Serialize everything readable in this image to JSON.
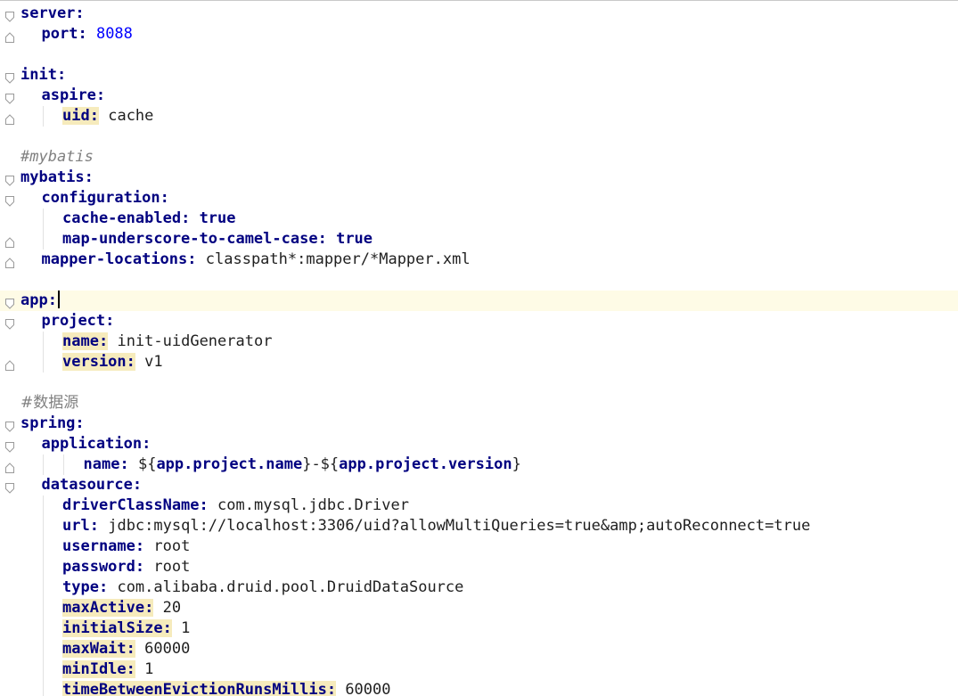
{
  "editor": {
    "current_line": 14,
    "lines": [
      {
        "indent": 0,
        "key": "server",
        "fold": "open"
      },
      {
        "indent": 1,
        "key": "port",
        "value": "8088",
        "value_type": "number",
        "fold": "close"
      },
      {
        "blank": true
      },
      {
        "indent": 0,
        "key": "init",
        "fold": "open"
      },
      {
        "indent": 1,
        "key": "aspire",
        "fold": "open"
      },
      {
        "indent": 2,
        "key": "uid",
        "value": "cache",
        "highlight": true,
        "fold": "close"
      },
      {
        "blank": true
      },
      {
        "comment": "#mybatis"
      },
      {
        "indent": 0,
        "key": "mybatis",
        "fold": "open"
      },
      {
        "indent": 1,
        "key": "configuration",
        "fold": "open"
      },
      {
        "indent": 2,
        "key": "cache-enabled",
        "value": "true",
        "value_type": "keyword"
      },
      {
        "indent": 2,
        "key": "map-underscore-to-camel-case",
        "value": "true",
        "value_type": "keyword",
        "fold": "close"
      },
      {
        "indent": 1,
        "key": "mapper-locations",
        "value": "classpath*:mapper/*Mapper.xml",
        "fold": "close"
      },
      {
        "blank": true
      },
      {
        "indent": 0,
        "key": "app",
        "fold": "open",
        "caret": true
      },
      {
        "indent": 1,
        "key": "project",
        "fold": "open"
      },
      {
        "indent": 2,
        "key": "name",
        "value": "init-uidGenerator",
        "highlight": true
      },
      {
        "indent": 2,
        "key": "version",
        "value": "v1",
        "highlight": true,
        "fold": "close"
      },
      {
        "blank": true
      },
      {
        "comment": "#数据源",
        "cjk": true
      },
      {
        "indent": 0,
        "key": "spring",
        "fold": "open"
      },
      {
        "indent": 1,
        "key": "application",
        "fold": "open"
      },
      {
        "indent": 3,
        "key": "name",
        "parts": [
          {
            "t": "${",
            "s": "v"
          },
          {
            "t": "app.project.name",
            "s": "k"
          },
          {
            "t": "}-${",
            "s": "v"
          },
          {
            "t": "app.project.version",
            "s": "k"
          },
          {
            "t": "}",
            "s": "v"
          }
        ],
        "fold": "close"
      },
      {
        "indent": 1,
        "key": "datasource",
        "fold": "open"
      },
      {
        "indent": 2,
        "key": "driverClassName",
        "value": "com.mysql.jdbc.Driver"
      },
      {
        "indent": 2,
        "key": "url",
        "value": "jdbc:mysql://localhost:3306/uid?allowMultiQueries=true&amp;autoReconnect=true"
      },
      {
        "indent": 2,
        "key": "username",
        "value": "root"
      },
      {
        "indent": 2,
        "key": "password",
        "value": "root"
      },
      {
        "indent": 2,
        "key": "type",
        "value": "com.alibaba.druid.pool.DruidDataSource"
      },
      {
        "indent": 2,
        "key": "maxActive",
        "value": "20",
        "highlight": true
      },
      {
        "indent": 2,
        "key": "initialSize",
        "value": "1",
        "highlight": true
      },
      {
        "indent": 2,
        "key": "maxWait",
        "value": "60000",
        "highlight": true
      },
      {
        "indent": 2,
        "key": "minIdle",
        "value": "1",
        "highlight": true
      },
      {
        "indent": 2,
        "key": "timeBetweenEvictionRunsMillis",
        "value": "60000",
        "highlight": true
      }
    ]
  },
  "colors": {
    "key": "#000080",
    "number": "#0000ff",
    "comment": "#808080",
    "key_highlight": "#f6ebbc",
    "current_line": "#fefbe6"
  },
  "icons": {
    "fold_open": "fold-open-icon",
    "fold_close": "fold-close-icon"
  }
}
